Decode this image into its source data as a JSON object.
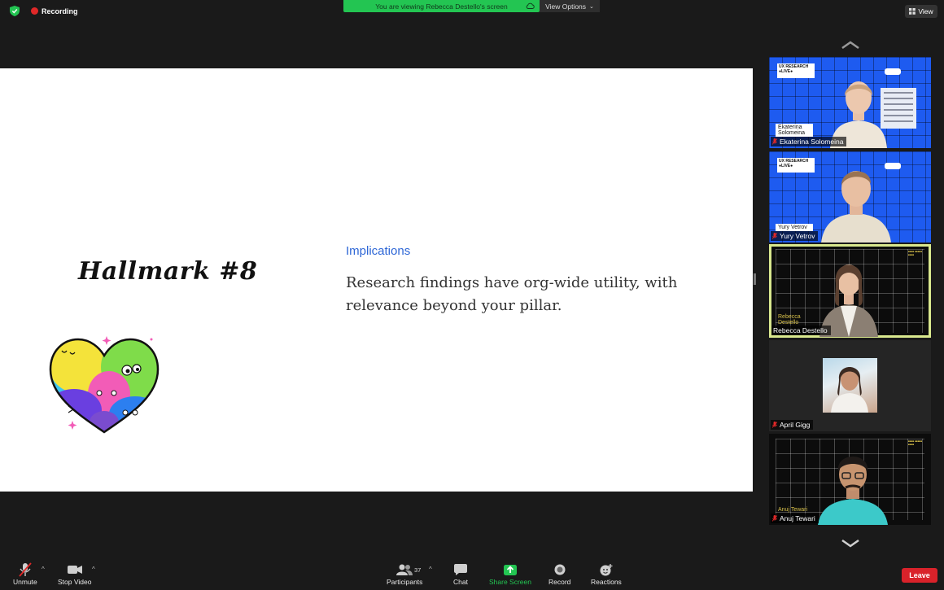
{
  "top": {
    "recording_label": "Recording",
    "banner_text": "You are viewing Rebecca Destello's screen",
    "view_options_label": "View Options",
    "view_label": "View"
  },
  "slide": {
    "hallmark": "Hallmark #8",
    "heading": "Implications",
    "body": "Research findings have org-wide utility, with relevance beyond your pillar."
  },
  "participants": [
    {
      "name": "Ekaterina Solomeina",
      "inner_label": "Ekaterina Solomeina",
      "muted": true
    },
    {
      "name": "Yury Vetrov",
      "inner_label": "Yury Vetrov",
      "muted": true
    },
    {
      "name": "Rebecca Destello",
      "inner_label": "Rebecca Destello",
      "muted": false,
      "active": true
    },
    {
      "name": "April Gigg",
      "muted": true
    },
    {
      "name": "Anuj Tewari",
      "inner_label": "Anuj Tewari",
      "muted": true
    }
  ],
  "stream_text": {
    "ux_research": "UX RESEARCH",
    "live": "●LIVE●"
  },
  "toolbar": {
    "unmute": "Unmute",
    "stop_video": "Stop Video",
    "participants": "Participants",
    "participant_count": "37",
    "chat": "Chat",
    "share_screen": "Share Screen",
    "record": "Record",
    "reactions": "Reactions",
    "leave": "Leave"
  },
  "colors": {
    "share_green": "#23c552",
    "leave_red": "#d9222a",
    "active_speaker": "#d9e88e",
    "link_blue": "#2d66d6"
  }
}
